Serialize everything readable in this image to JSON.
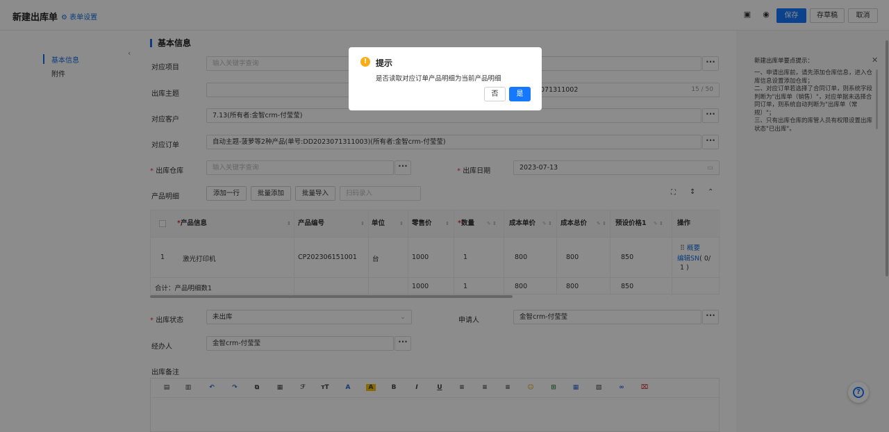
{
  "header": {
    "title": "新建出库单",
    "form_settings": "表单设置",
    "save": "保存",
    "draft": "存草稿",
    "cancel": "取消"
  },
  "nav": {
    "items": [
      {
        "label": "基本信息"
      },
      {
        "label": "附件"
      }
    ]
  },
  "section_title": "基本信息",
  "form": {
    "project": {
      "label": "对应项目",
      "placeholder": "输入关键字查询"
    },
    "subject": {
      "label": "出库主题",
      "value": "071311002",
      "count": "15 / 50"
    },
    "customer": {
      "label": "对应客户",
      "value": "7.13(所有者:金智crm-付莹莹)"
    },
    "order": {
      "label": "对应订单",
      "value": "自动主题-菠萝等2种产品(单号:DD2023071311003)(所有者:金智crm-付莹莹)"
    },
    "warehouse": {
      "label": "出库仓库",
      "placeholder": "输入关键字查询"
    },
    "date": {
      "label": "出库日期",
      "value": "2023-07-13"
    },
    "details": {
      "label": "产品明细",
      "add_row": "添加一行",
      "batch_add": "批量添加",
      "batch_import": "批量导入",
      "scan_placeholder": "扫码录入"
    },
    "status": {
      "label": "出库状态",
      "value": "未出库"
    },
    "applicant": {
      "label": "申请人",
      "value": "金智crm-付莹莹"
    },
    "handler": {
      "label": "经办人",
      "value": "金智crm-付莹莹"
    },
    "remarks": {
      "label": "出库备注"
    }
  },
  "table": {
    "headers": {
      "product_info": "产品信息",
      "product_code": "产品编号",
      "unit": "单位",
      "retail_price": "零售价",
      "qty": "数量",
      "unit_cost": "成本单价",
      "total_cost": "成本总价",
      "preset_price": "预设价格1",
      "ops": "操作"
    },
    "row": {
      "index": "1",
      "product": "激光打印机",
      "code": "CP202306151001",
      "unit": "台",
      "retail": "1000",
      "qty": "1",
      "unit_cost": "800",
      "total_cost": "800",
      "preset": "850",
      "op_summary": "概要",
      "op_edit_sn": "编辑SN",
      "op_sn_count": "( 0/",
      "op_sn_count2": "1 )"
    },
    "total": {
      "label": "合计：产品明细数1",
      "retail": "1000",
      "qty": "1",
      "unit_cost": "800",
      "total_cost": "800",
      "preset": "850"
    }
  },
  "tips": {
    "title": "新建出库单要点提示：",
    "lines": [
      "一、申请出库前，请先添加仓库信息，进入仓库信息设置添加仓库；",
      "二、对应订单若选择了合同订单，则系统字段判断为\"出库单（销售）\"，对应单据未选择合同订单，则系统自动判断为\"出库单（常规）\"；",
      "三、只有出库仓库的库管人员有权限设置出库状态\"已出库\"。"
    ]
  },
  "modal": {
    "title": "提示",
    "message": "是否读取对应订单产品明细为当前产品明细",
    "no": "否",
    "yes": "是"
  },
  "colors": {
    "primary": "#1677ff",
    "warning": "#faad14",
    "required": "#e33"
  }
}
